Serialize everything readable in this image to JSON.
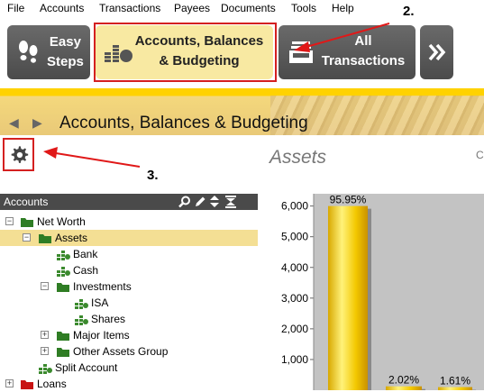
{
  "menu": [
    "File",
    "Accounts",
    "Transactions",
    "Payees",
    "Documents",
    "Tools",
    "Help"
  ],
  "toolbar": {
    "easy_steps": [
      "Easy",
      "Steps"
    ],
    "accounts": [
      "Accounts, Balances",
      "& Budgeting"
    ],
    "all_tx": [
      "All",
      "Transactions"
    ]
  },
  "annotations": {
    "a2": "2.",
    "a3": "3."
  },
  "page_title": "Accounts, Balances & Budgeting",
  "section_title": "Assets",
  "right_edge_text": "C",
  "panel": {
    "header": "Accounts",
    "tree": [
      {
        "label": "Net Worth",
        "level": 0,
        "expander": "−",
        "icon": "green-folder"
      },
      {
        "label": "Assets",
        "level": 1,
        "expander": "−",
        "icon": "green-folder",
        "selected": true
      },
      {
        "label": "Bank",
        "level": 2,
        "icon": "account-icon"
      },
      {
        "label": "Cash",
        "level": 2,
        "icon": "account-icon"
      },
      {
        "label": "Investments",
        "level": 2,
        "expander": "−",
        "icon": "green-folder"
      },
      {
        "label": "ISA",
        "level": 3,
        "icon": "account-icon"
      },
      {
        "label": "Shares",
        "level": 3,
        "icon": "account-icon"
      },
      {
        "label": "Major Items",
        "level": 2,
        "expander": "+",
        "icon": "green-folder"
      },
      {
        "label": "Other Assets Group",
        "level": 2,
        "expander": "+",
        "icon": "green-folder"
      },
      {
        "label": "Split Account",
        "level": 1,
        "icon": "account-icon"
      },
      {
        "label": "Loans",
        "level": 0,
        "expander": "+",
        "icon": "red-folder"
      }
    ]
  },
  "chart_data": {
    "type": "bar",
    "ylim": [
      0,
      6400
    ],
    "ticks": [
      1000,
      2000,
      3000,
      4000,
      5000,
      6000
    ],
    "tick_labels": [
      "1,000",
      "2,000",
      "3,000",
      "4,000",
      "5,000",
      "6,000"
    ],
    "values": [
      6000,
      126,
      101
    ],
    "data_labels": [
      "95.95%",
      "2.02%",
      "1.61%"
    ]
  }
}
